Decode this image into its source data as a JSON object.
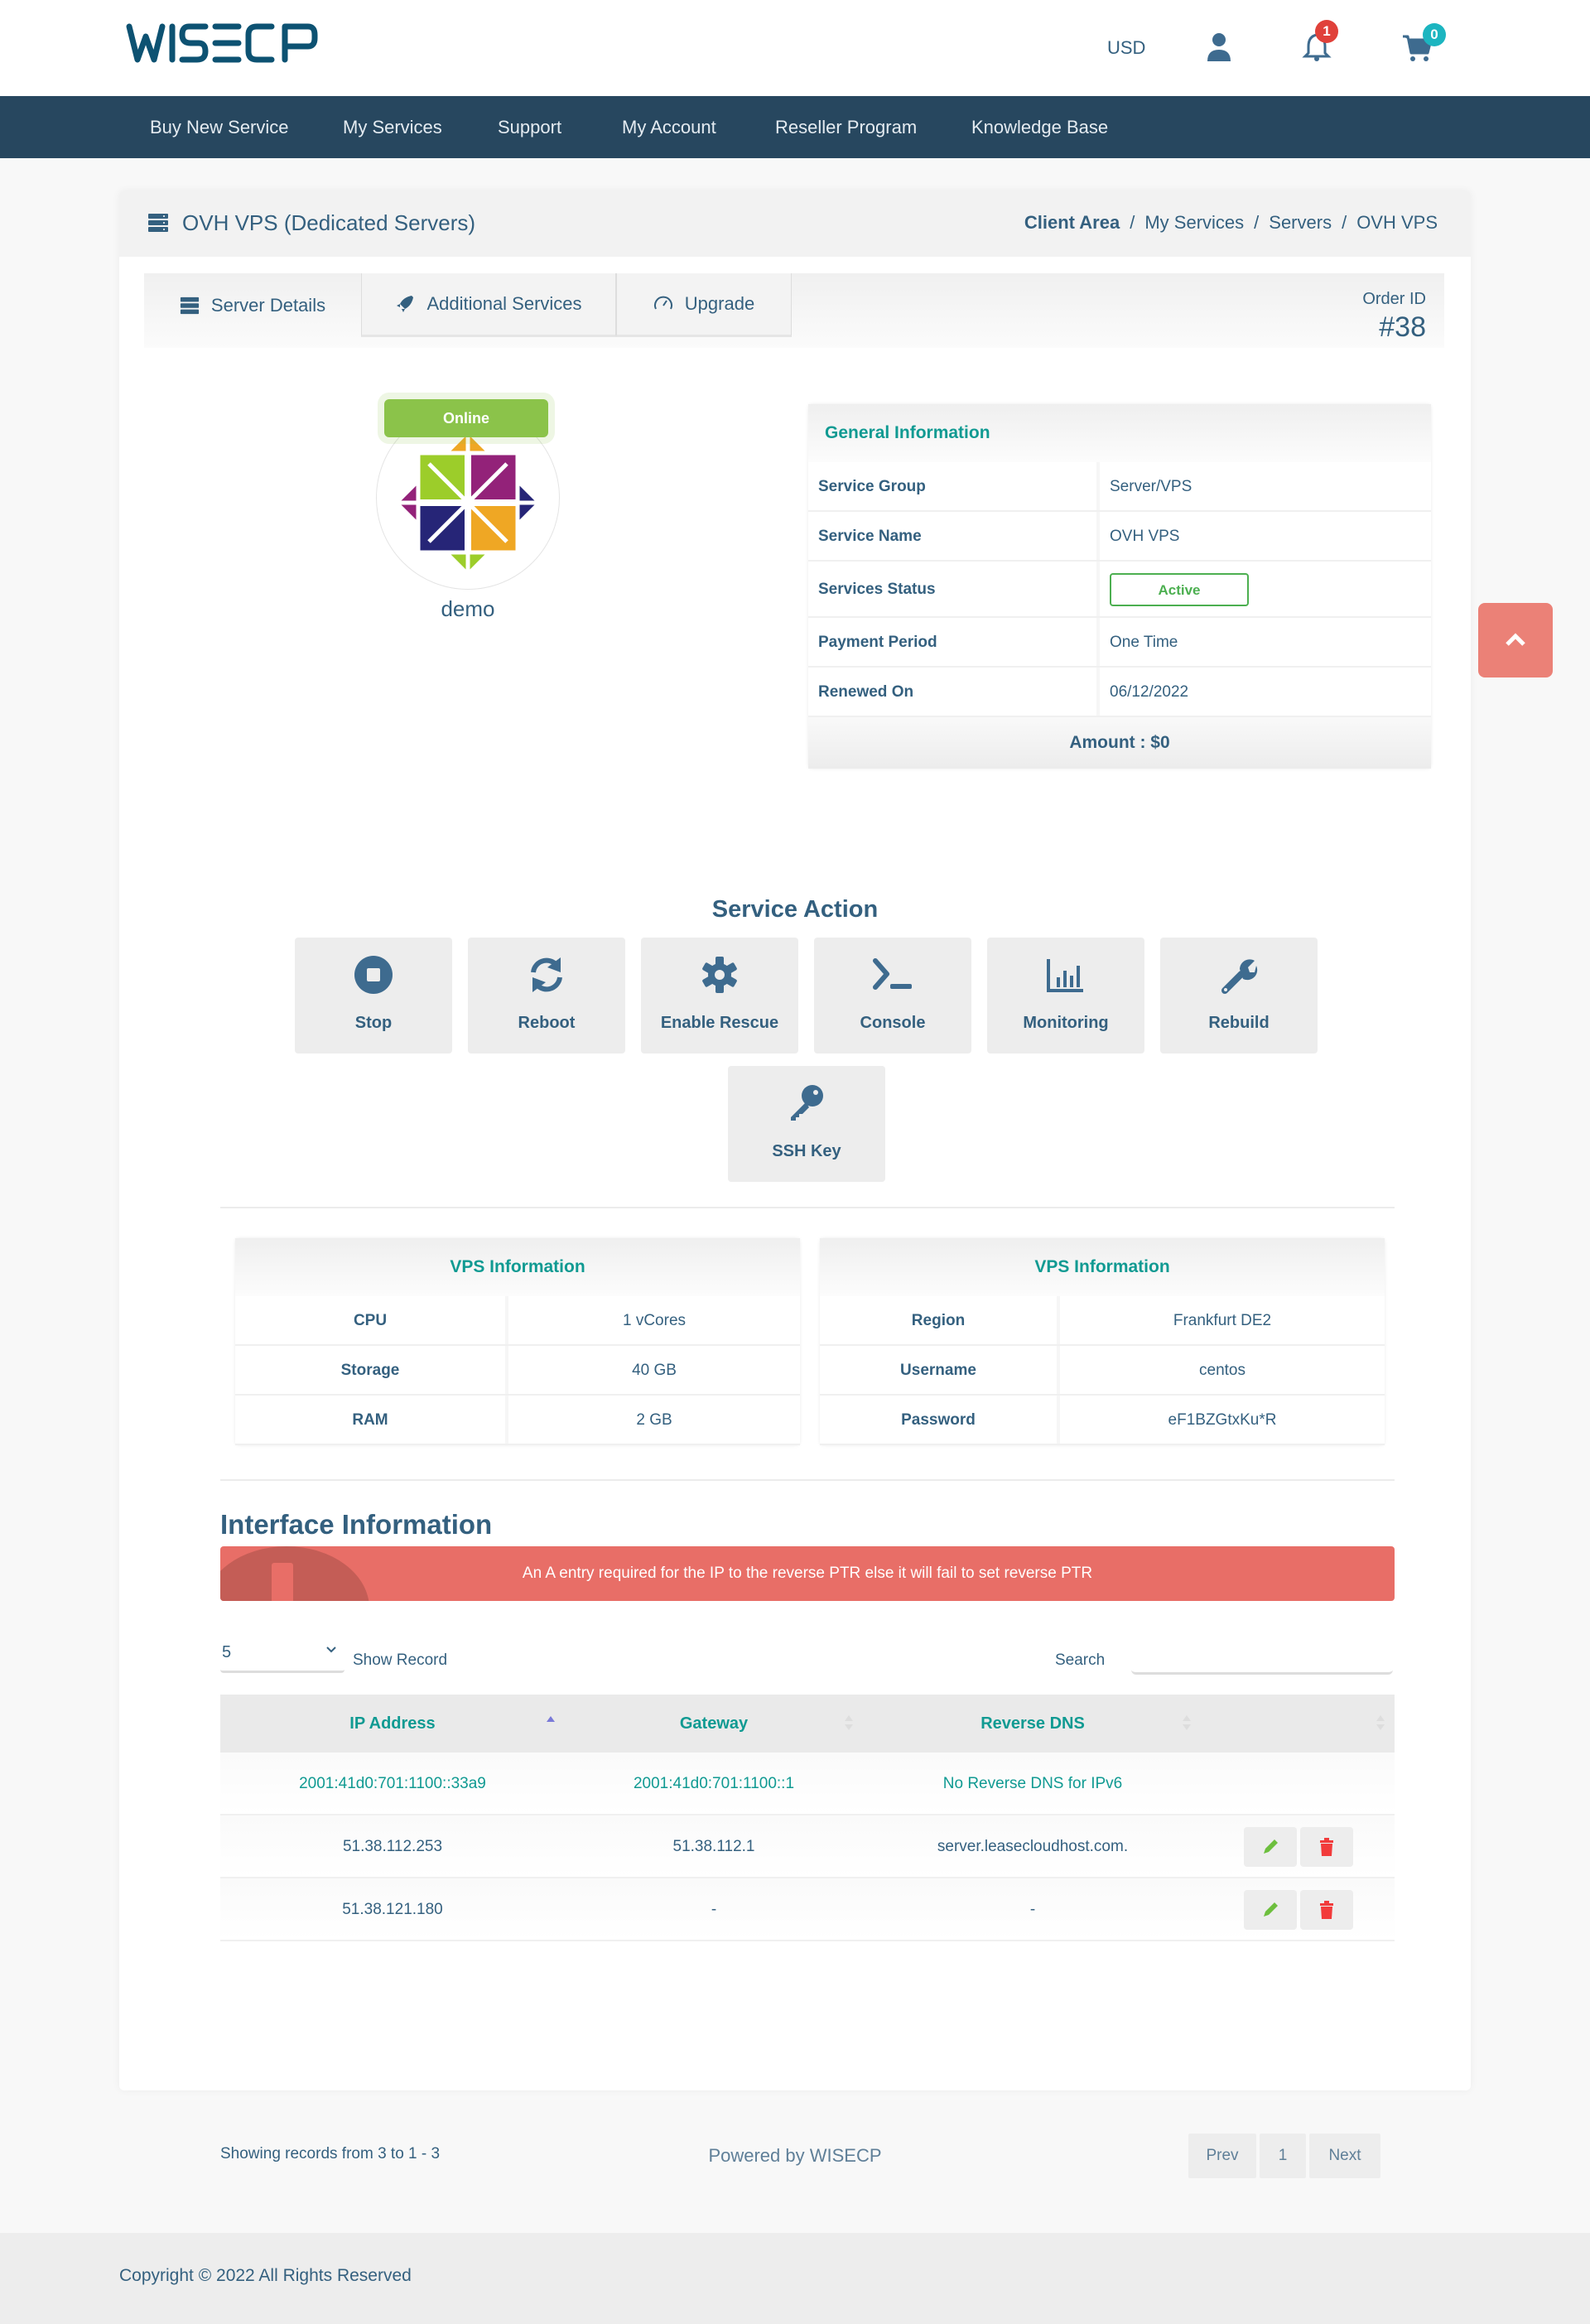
{
  "header": {
    "brand": "WISECP",
    "currency": "USD",
    "notifications_count": "1",
    "cart_count": "0",
    "icons": {
      "user": "user-icon",
      "notifications": "bell-icon",
      "cart": "cart-icon"
    }
  },
  "nav": {
    "items": [
      {
        "label": "Buy New Service"
      },
      {
        "label": "My Services"
      },
      {
        "label": "Support"
      },
      {
        "label": "My Account"
      },
      {
        "label": "Reseller Program"
      },
      {
        "label": "Knowledge Base"
      }
    ]
  },
  "page": {
    "title": "OVH VPS (Dedicated Servers)",
    "breadcrumb": [
      "Client Area",
      "My Services",
      "Servers",
      "OVH VPS"
    ],
    "tabs": [
      {
        "label": "Server Details",
        "icon": "server-icon",
        "active": true
      },
      {
        "label": "Additional Services",
        "icon": "rocket-icon",
        "active": false
      },
      {
        "label": "Upgrade",
        "icon": "speedometer-icon",
        "active": false
      }
    ],
    "order_label": "Order ID",
    "order_id": "#38"
  },
  "server": {
    "status": "Online",
    "os_logo": "centos-logo",
    "hostname": "demo"
  },
  "general_info": {
    "title": "General Information",
    "rows": [
      {
        "label": "Service Group",
        "value": "Server/VPS"
      },
      {
        "label": "Service Name",
        "value": "OVH VPS"
      },
      {
        "label": "Services Status",
        "value": "Active"
      },
      {
        "label": "Payment Period",
        "value": "One Time"
      },
      {
        "label": "Renewed On",
        "value": "06/12/2022"
      }
    ],
    "amount": "Amount : $0"
  },
  "service_action": {
    "title": "Service Action",
    "buttons": [
      {
        "label": "Stop",
        "icon": "stop-icon"
      },
      {
        "label": "Reboot",
        "icon": "refresh-icon"
      },
      {
        "label": "Enable Rescue",
        "icon": "gear-icon"
      },
      {
        "label": "Console",
        "icon": "terminal-icon"
      },
      {
        "label": "Monitoring",
        "icon": "chart-icon"
      },
      {
        "label": "Rebuild",
        "icon": "wrench-icon"
      },
      {
        "label": "SSH Key",
        "icon": "key-icon"
      }
    ]
  },
  "vps_info_left": {
    "title": "VPS Information",
    "rows": [
      {
        "label": "CPU",
        "value": "1 vCores"
      },
      {
        "label": "Storage",
        "value": "40 GB"
      },
      {
        "label": "RAM",
        "value": "2 GB"
      }
    ]
  },
  "vps_info_right": {
    "title": "VPS Information",
    "rows": [
      {
        "label": "Region",
        "value": "Frankfurt DE2"
      },
      {
        "label": "Username",
        "value": "centos"
      },
      {
        "label": "Password",
        "value": "eF1BZGtxKu*R"
      }
    ]
  },
  "interface": {
    "title": "Interface Information",
    "alert": "An A entry required for the IP to the reverse PTR else it will fail to set reverse PTR",
    "page_size": "5",
    "show_record_label": "Show Record",
    "search_label": "Search",
    "search_value": "",
    "columns": [
      "IP Address",
      "Gateway",
      "Reverse DNS",
      ""
    ],
    "rows": [
      {
        "ip": "2001:41d0:701:1100::33a9",
        "gateway": "2001:41d0:701:1100::1",
        "rdns": "No Reverse DNS for IPv6",
        "actions": false
      },
      {
        "ip": "51.38.112.253",
        "gateway": "51.38.112.1",
        "rdns": "server.leasecloudhost.com.",
        "actions": true
      },
      {
        "ip": "51.38.121.180",
        "gateway": "-",
        "rdns": "-",
        "actions": true
      }
    ],
    "showing": "Showing records from 3 to 1 - 3",
    "pagination": {
      "prev": "Prev",
      "current": "1",
      "next": "Next"
    }
  },
  "footer": {
    "powered_by": "Powered by WISECP",
    "copyright": "Copyright © 2022 All Rights Reserved"
  },
  "colors": {
    "primary": "#34607f",
    "nav_bg": "#27475f",
    "accent_teal": "#109a92",
    "online_green": "#8bc34a",
    "alert_red": "#e86e67",
    "notification_badge": "#e0413a",
    "cart_badge": "#1cb5c0"
  }
}
